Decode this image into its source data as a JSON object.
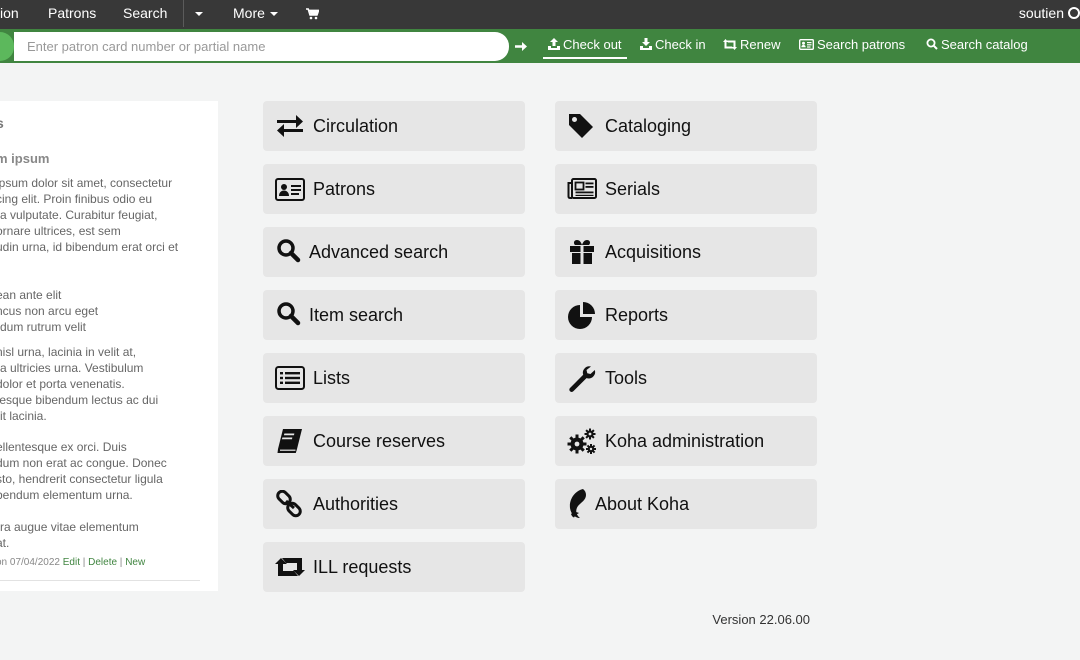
{
  "topnav": {
    "items": [
      "ion",
      "Patrons",
      "Search",
      "More"
    ],
    "user": "soutien"
  },
  "search": {
    "placeholder": "Enter patron card number or partial name"
  },
  "tabs": [
    "Check out",
    "Check in",
    "Renew",
    "Search patrons",
    "Search catalog"
  ],
  "news": {
    "title": "s",
    "item_title": "m ipsum",
    "paragraphs": [
      [
        "ipsum dolor sit amet, consectetur",
        "cing elit. Proin finibus odio eu",
        "ra vulputate. Curabitur feugiat,",
        "ornare ultrices, est sem",
        "udin urna, id bibendum erat orci et"
      ],
      [
        "ean ante elit",
        "ncus non arcu eget",
        "rdum rutrum velit"
      ],
      [
        "nisl urna, lacinia in velit at,",
        "ra ultricies urna. Vestibulum",
        "dolor et porta venenatis.",
        "tesque bibendum lectus ac dui",
        "rit lacinia."
      ],
      [
        "ellentesque ex orci. Duis",
        "dum non erat ac congue. Donec",
        "sto, hendrerit consectetur ligula",
        "bendum elementum urna."
      ],
      [
        "rra augue vitae elementum",
        "at."
      ]
    ],
    "posted": "on 07/04/2022",
    "edit": "Edit",
    "delete": "Delete",
    "new": "New"
  },
  "modules_left": [
    "Circulation",
    "Patrons",
    "Advanced search",
    "Item search",
    "Lists",
    "Course reserves",
    "Authorities",
    "ILL requests"
  ],
  "modules_right": [
    "Cataloging",
    "Serials",
    "Acquisitions",
    "Reports",
    "Tools",
    "Koha administration",
    "About Koha"
  ],
  "icons": {
    "modules_left": [
      "exchange-icon",
      "id-card-icon",
      "search-icon",
      "search-icon",
      "list-icon",
      "book-icon",
      "link-icon",
      "retweet-icon"
    ],
    "modules_right": [
      "tag-icon",
      "newspaper-icon",
      "gift-icon",
      "pie-chart-icon",
      "wrench-icon",
      "gears-icon",
      "koha-logo-icon"
    ]
  },
  "version": "Version 22.06.00",
  "colors": {
    "topbar": "#383838",
    "searchbar": "#408540",
    "accent_green": "#5cb85c",
    "link_green": "#408540",
    "tile": "#e6e6e6",
    "page": "#f3f4f4"
  }
}
